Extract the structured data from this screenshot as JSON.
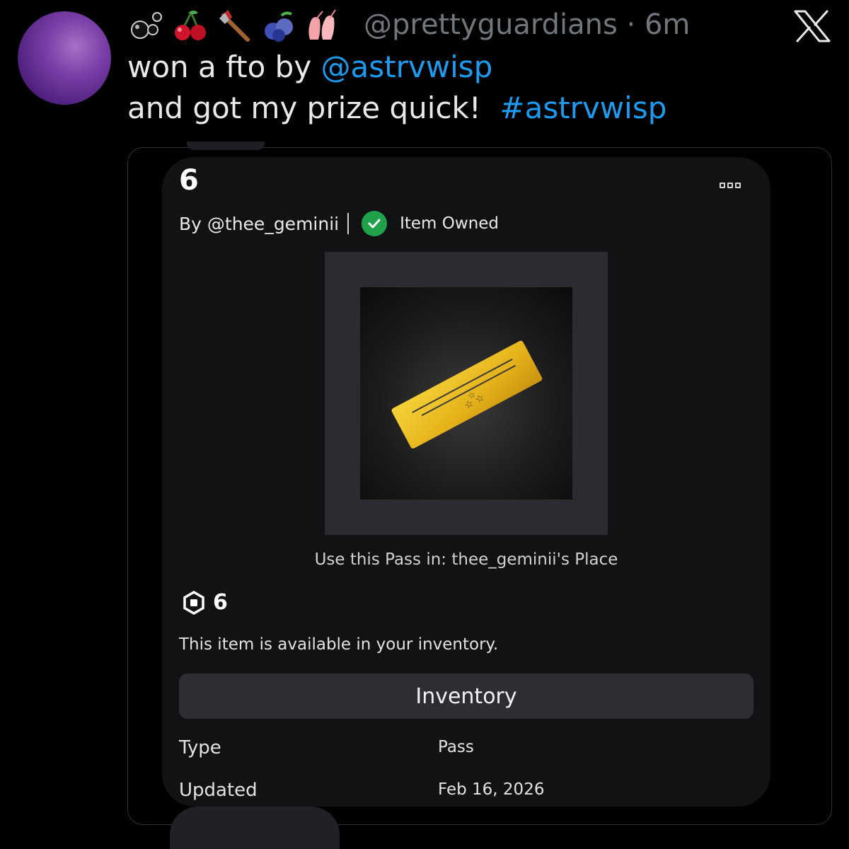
{
  "tweet": {
    "emojis": [
      "bubbles-emoji",
      "cherries-emoji",
      "axe-emoji",
      "blueberries-emoji",
      "ballet-shoes-emoji"
    ],
    "handle": "@prettyguardians",
    "time_sep": "·",
    "time": "6m",
    "line1_prefix": "won a fto by ",
    "line1_mention": "@astrvwisp",
    "line2_prefix": "and got my prize quick!  ",
    "line2_hashtag": "#astrvwisp"
  },
  "colors": {
    "link": "#1d9bf0",
    "card_bg": "#111214",
    "owned_check": "#1fa24a",
    "ticket_gold": "#e8b81a"
  },
  "card": {
    "title": "6",
    "byline_prefix": "By ",
    "creator": "@thee_geminii",
    "owned_label": "Item Owned",
    "use_pass": "Use this Pass in: thee_geminii's Place",
    "price": "6",
    "availability": "This item is available in your inventory.",
    "button_label": "Inventory",
    "details": [
      {
        "label": "Type",
        "value": "Pass"
      },
      {
        "label": "Updated",
        "value": "Feb 16, 2026"
      }
    ]
  }
}
